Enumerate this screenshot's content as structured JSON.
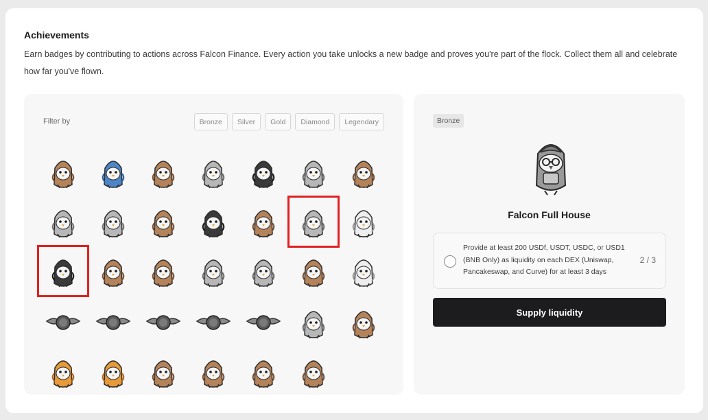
{
  "header": {
    "title": "Achievements",
    "description": "Earn badges by contributing to actions across Falcon Finance. Every action you take unlocks a new badge and proves you're part of the flock. Collect them all and celebrate how far you've flown."
  },
  "filter": {
    "label": "Filter by",
    "options": [
      "Bronze",
      "Silver",
      "Gold",
      "Diamond",
      "Legendary"
    ]
  },
  "badges": [
    {
      "icon": "egg-falcon-icon"
    },
    {
      "icon": "blanket-falcon-icon"
    },
    {
      "icon": "plaid-falcon-icon"
    },
    {
      "icon": "suit-falcon-icon"
    },
    {
      "icon": "jacket-falcon-icon"
    },
    {
      "icon": "robot-falcon-icon"
    },
    {
      "icon": "plane-falcon-icon"
    },
    {
      "icon": "grey-plane-falcon-icon"
    },
    {
      "icon": "grey-plane-falcon-icon"
    },
    {
      "icon": "jet-falcon-icon"
    },
    {
      "icon": "dark-jet-falcon-icon"
    },
    {
      "icon": "cap-falcon-icon"
    },
    {
      "icon": "full-house-falcon-icon"
    },
    {
      "icon": "hood-falcon-icon"
    },
    {
      "icon": "sunglasses-falcon-icon"
    },
    {
      "icon": "pair-falcon-icon"
    },
    {
      "icon": "trio-falcon-icon"
    },
    {
      "icon": "grey-trio-falcon-icon"
    },
    {
      "icon": "grey-flock-falcon-icon"
    },
    {
      "icon": "big-flock-falcon-icon"
    },
    {
      "icon": "winged-falcon-icon"
    },
    {
      "icon": "wings-1-icon"
    },
    {
      "icon": "wings-2-icon"
    },
    {
      "icon": "wings-3-icon"
    },
    {
      "icon": "wings-4-icon"
    },
    {
      "icon": "wings-5-icon"
    },
    {
      "icon": "detective-falcon-icon"
    },
    {
      "icon": "flag-flock-falcon-icon"
    },
    {
      "icon": "butterfly-falcon-icon"
    },
    {
      "icon": "big-butterfly-falcon-icon"
    },
    {
      "icon": "heart-falcon-icon"
    },
    {
      "icon": "yellow-heart-falcon-icon"
    },
    {
      "icon": "jar-falcon-icon"
    },
    {
      "icon": "green-jar-falcon-icon"
    }
  ],
  "selected_badge_index": 12,
  "highlighted_badge_indices": [
    12,
    14
  ],
  "detail": {
    "tier": "Bronze",
    "name": "Falcon Full House",
    "task": "Provide at least 200 USDf, USDT, USDC, or USD1 (BNB Only) as liquidity on each DEX (Uniswap, Pancakeswap, and Curve) for at least 3 days",
    "progress": "2 / 3",
    "cta": "Supply liquidity"
  },
  "colors": {
    "accent": "#1c1c1e",
    "selection": "#e02020",
    "panel": "#f7f7f7",
    "page_bg": "#ebebeb"
  }
}
